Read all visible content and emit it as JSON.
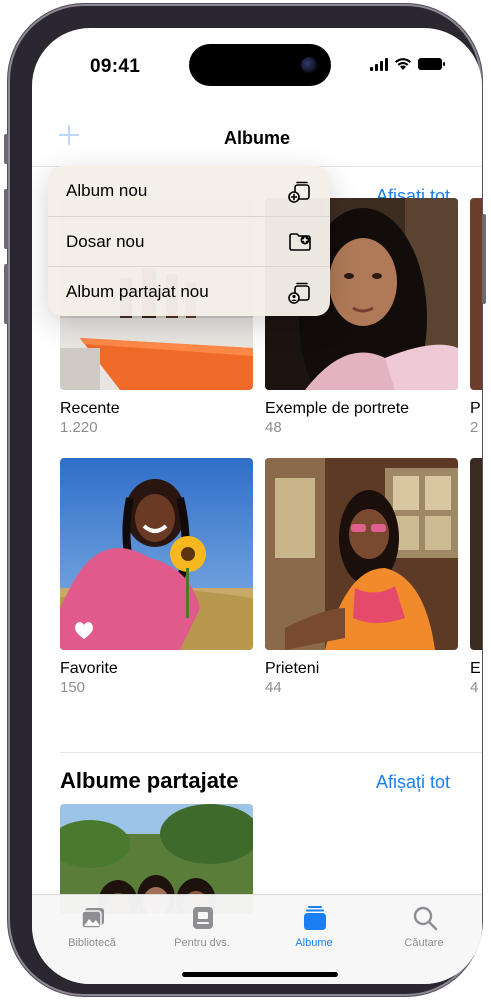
{
  "status_bar": {
    "time": "09:41"
  },
  "nav": {
    "title": "Albume"
  },
  "my_albums": {
    "see_all": "Afișați tot"
  },
  "menu": {
    "items": [
      {
        "label": "Album nou",
        "icon": "album-stack-plus-icon"
      },
      {
        "label": "Dosar nou",
        "icon": "folder-plus-icon"
      },
      {
        "label": "Album partajat nou",
        "icon": "shared-album-plus-icon"
      }
    ]
  },
  "albums": [
    {
      "title": "Recente",
      "count": "1.220"
    },
    {
      "title": "Exemple de portrete",
      "count": "48"
    },
    {
      "title": "P",
      "count": "2"
    },
    {
      "title": "Favorite",
      "count": "150"
    },
    {
      "title": "Prieteni",
      "count": "44"
    },
    {
      "title": "E",
      "count": "4"
    }
  ],
  "shared_albums": {
    "title": "Albume partajate",
    "see_all": "Afișați tot"
  },
  "tabbar": {
    "tabs": [
      {
        "label": "Bibliotecă",
        "icon": "photo-library-icon",
        "active": false
      },
      {
        "label": "Pentru dvs.",
        "icon": "for-you-icon",
        "active": false
      },
      {
        "label": "Albume",
        "icon": "albums-icon",
        "active": true
      },
      {
        "label": "Căutare",
        "icon": "search-icon",
        "active": false
      }
    ]
  },
  "colors": {
    "accent": "#1a7ff2",
    "menu_bg": "#f4eee8",
    "secondary_text": "#8e8e93"
  }
}
